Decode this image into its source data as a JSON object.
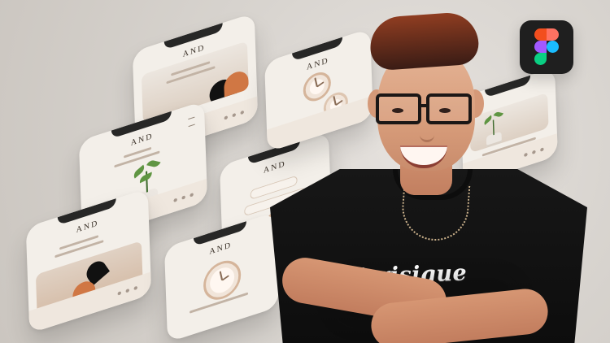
{
  "scene": {
    "brand_marks": [
      "AND",
      "AND",
      "AND",
      "AND",
      "AND",
      "AND"
    ],
    "shirt_text": "Kerisique",
    "colors": {
      "background": "#d9d5d1",
      "accent_orange": "#d07744",
      "accent_wood": "#b07b52",
      "shirt": "#111111"
    },
    "icons": {
      "app_badge": "figma-icon"
    }
  }
}
